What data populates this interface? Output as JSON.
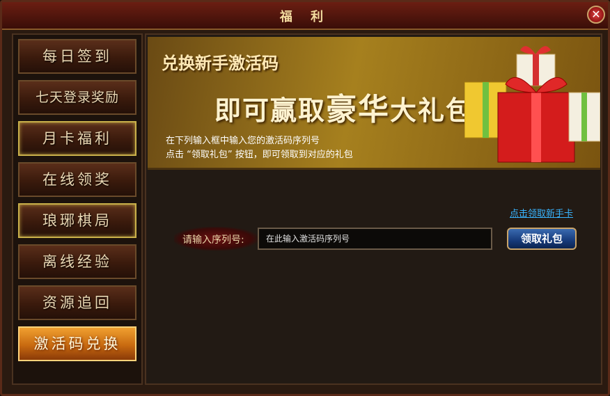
{
  "window": {
    "title": "福 利"
  },
  "sidebar": {
    "items": [
      {
        "label": "每日签到"
      },
      {
        "label": "七天登录奖励"
      },
      {
        "label": "月卡福利"
      },
      {
        "label": "在线领奖"
      },
      {
        "label": "琅琊棋局"
      },
      {
        "label": "离线经验"
      },
      {
        "label": "资源追回"
      },
      {
        "label": "激活码兑换",
        "active": true
      }
    ]
  },
  "banner": {
    "title": "兑换新手激活码",
    "sub_pre": "即可赢取",
    "sub_big": "豪华",
    "sub_post": "大礼包",
    "note1": "在下列输入框中输入您的激活码序列号",
    "note2": "点击 “领取礼包” 按钮，即可领取到对应的礼包"
  },
  "redeem": {
    "link": "点击领取新手卡",
    "label": "请输入序列号:",
    "placeholder": "在此输入激活码序列号",
    "button": "领取礼包"
  },
  "colors": {
    "accent": "#c86a10",
    "link": "#38b4ff",
    "button": "#163a7a"
  }
}
